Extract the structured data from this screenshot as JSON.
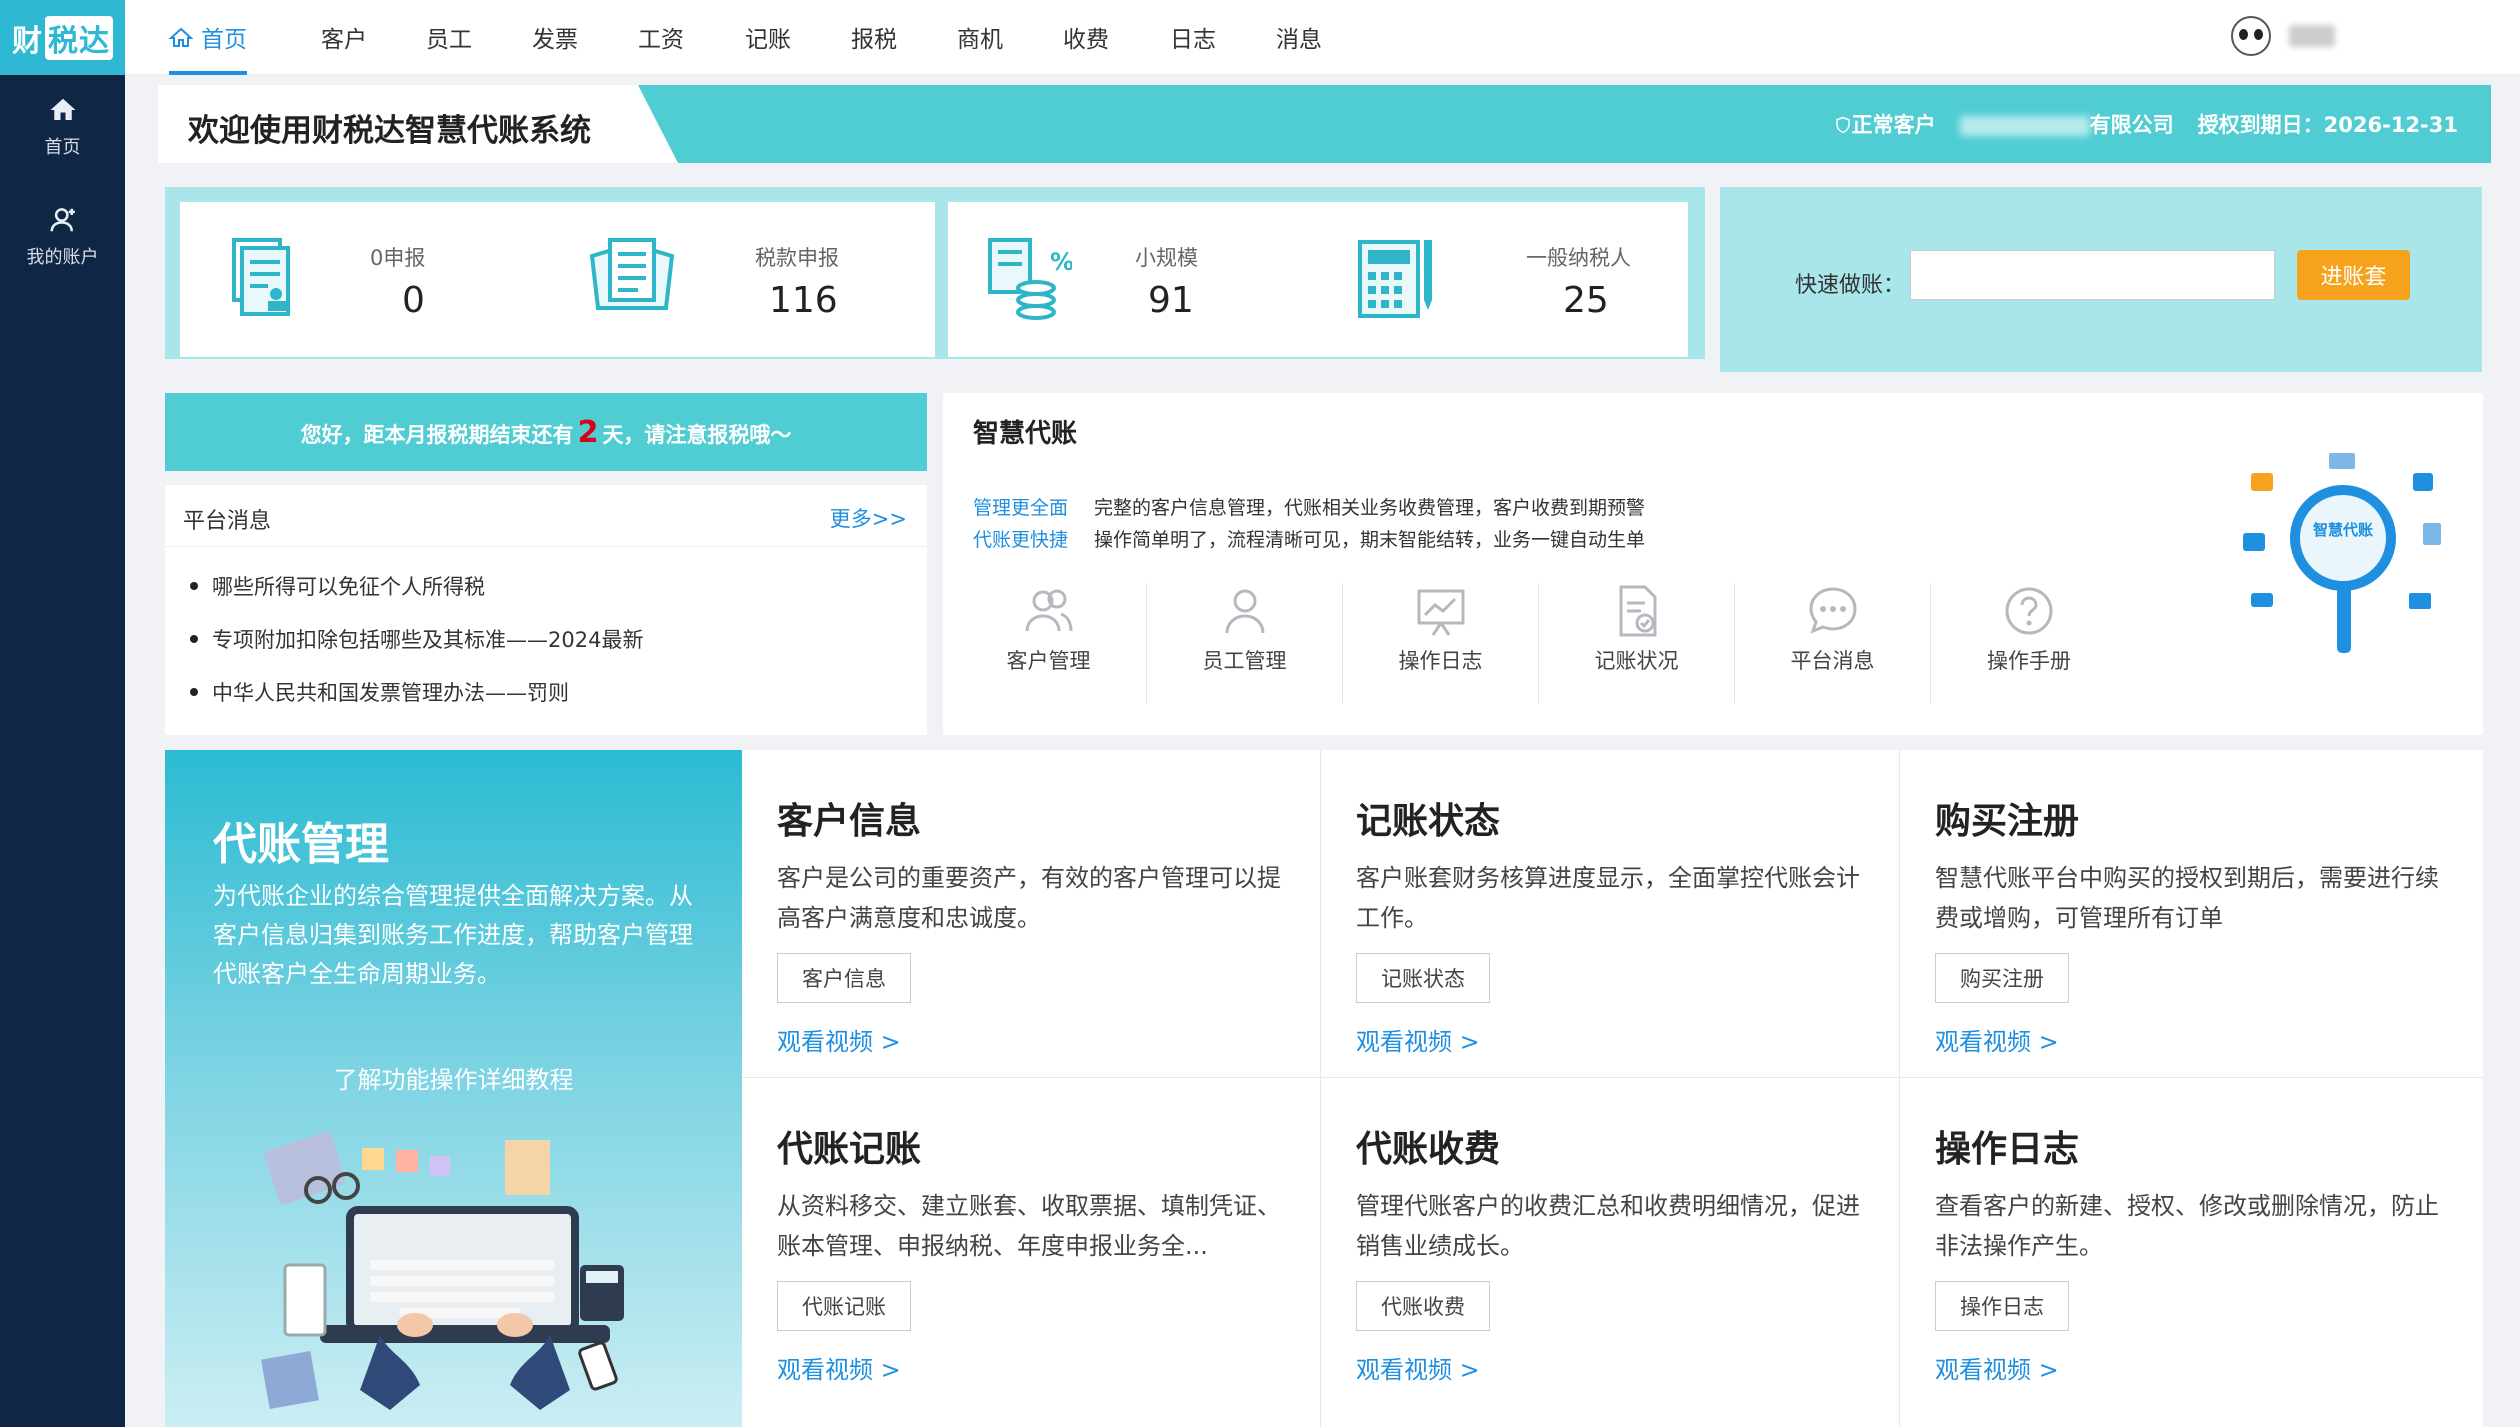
{
  "app": {
    "logo_left": "财",
    "logo_box": "税达"
  },
  "sidebar": {
    "items": [
      {
        "label": "首页",
        "icon": "home-icon"
      },
      {
        "label": "我的账户",
        "icon": "user-icon"
      }
    ]
  },
  "topnav": {
    "items": [
      "首页",
      "客户",
      "员工",
      "发票",
      "工资",
      "记账",
      "报税",
      "商机",
      "收费",
      "日志",
      "消息"
    ]
  },
  "banner": {
    "title": "欢迎使用财税达智慧代账系统",
    "status": "正常客户",
    "company": "有限公司",
    "auth": "授权到期日：2026-12-31"
  },
  "stats": [
    {
      "label": "0申报",
      "value": "0"
    },
    {
      "label": "税款申报",
      "value": "116"
    },
    {
      "label": "小规模",
      "value": "91"
    },
    {
      "label": "一般纳税人",
      "value": "25"
    }
  ],
  "quick": {
    "label": "快速做账：",
    "value": "",
    "button": "进账套"
  },
  "notice": {
    "prefix": "您好，距本月报税期结束还有",
    "days": "2",
    "suffix": "天，请注意报税哦～"
  },
  "platform": {
    "title": "平台消息",
    "more": "更多>>",
    "news": [
      "哪些所得可以免征个人所得税",
      "专项附加扣除包括哪些及其标准——2024最新",
      "中华人民共和国发票管理办法——罚则"
    ]
  },
  "smart": {
    "title": "智慧代账",
    "lines": [
      {
        "k": "管理更全面",
        "v": "完整的客户信息管理，代账相关业务收费管理，客户收费到期预警"
      },
      {
        "k": "代账更快捷",
        "v": "操作简单明了，流程清晰可见，期末智能结转，业务一键自动生单"
      }
    ],
    "features": [
      "客户管理",
      "员工管理",
      "操作日志",
      "记账状况",
      "平台消息",
      "操作手册"
    ],
    "deco_label": "智慧代账"
  },
  "promo": {
    "title": "代账管理",
    "desc": "为代账企业的综合管理提供全面解决方案。从客户信息归集到账务工作进度，帮助客户管理代账客户全生命周期业务。",
    "link": "了解功能操作详细教程"
  },
  "cards": [
    {
      "title": "客户信息",
      "desc": "客户是公司的重要资产，有效的客户管理可以提高客户满意度和忠诚度。",
      "button": "客户信息",
      "video": "观看视频 >"
    },
    {
      "title": "记账状态",
      "desc": "客户账套财务核算进度显示，全面掌控代账会计工作。",
      "button": "记账状态",
      "video": "观看视频 >"
    },
    {
      "title": "购买注册",
      "desc": "智慧代账平台中购买的授权到期后，需要进行续费或增购，可管理所有订单",
      "button": "购买注册",
      "video": "观看视频 >"
    },
    {
      "title": "代账记账",
      "desc": "从资料移交、建立账套、收取票据、填制凭证、账本管理、申报纳税、年度申报业务全...",
      "button": "代账记账",
      "video": "观看视频 >"
    },
    {
      "title": "代账收费",
      "desc": "管理代账客户的收费汇总和收费明细情况，促进销售业绩成长。",
      "button": "代账收费",
      "video": "观看视频 >"
    },
    {
      "title": "操作日志",
      "desc": "查看客户的新建、授权、修改或删除情况，防止非法操作产生。",
      "button": "操作日志",
      "video": "观看视频 >"
    }
  ],
  "colors": {
    "accent": "#1f8fe0",
    "teal": "#50cdd3",
    "sidebar": "#0f2744",
    "orange": "#f7a21c"
  }
}
